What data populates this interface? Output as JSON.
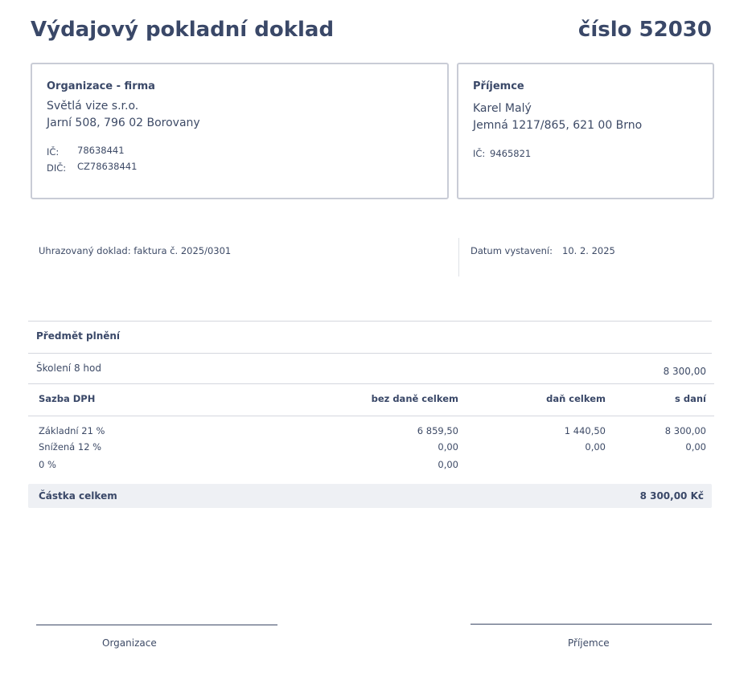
{
  "doc": {
    "title": "Výdajový pokladní doklad",
    "number_label": "číslo 52030"
  },
  "organization": {
    "heading": "Organizace - firma",
    "name": "Světlá vize s.r.o.",
    "address": "Jarní 508, 796 02 Borovany",
    "ic_label": "IČ:",
    "ic_value": "78638441",
    "dic_label": "DIČ:",
    "dic_value": "CZ78638441"
  },
  "recipient": {
    "heading": "Příjemce",
    "name": "Karel Malý",
    "address": "Jemná 1217/865, 621 00 Brno",
    "ic_label": "IČ:",
    "ic_value": "9465821"
  },
  "meta": {
    "paid_doc": "Uhrazovaný doklad: faktura č. 2025/0301",
    "issue_date_label": "Datum vystavení:",
    "issue_date_value": "10. 2. 2025"
  },
  "subject": {
    "header": "Předmět plnění",
    "item_name": "Školení 8 hod",
    "item_amount": "8 300,00"
  },
  "vat_table": {
    "headers": [
      "Sazba DPH",
      "bez daně celkem",
      "daň celkem",
      "s daní"
    ],
    "rows": [
      [
        "Základní 21 %",
        "6 859,50",
        "1 440,50",
        "8 300,00"
      ],
      [
        "Snížená 12 %",
        "0,00",
        "0,00",
        "0,00"
      ],
      [
        "0 %",
        "0,00",
        "",
        ""
      ]
    ]
  },
  "total": {
    "label": "Částka celkem",
    "value": "8 300,00 Kč"
  },
  "signatures": {
    "left": "Organizace",
    "right": "Příjemce"
  }
}
